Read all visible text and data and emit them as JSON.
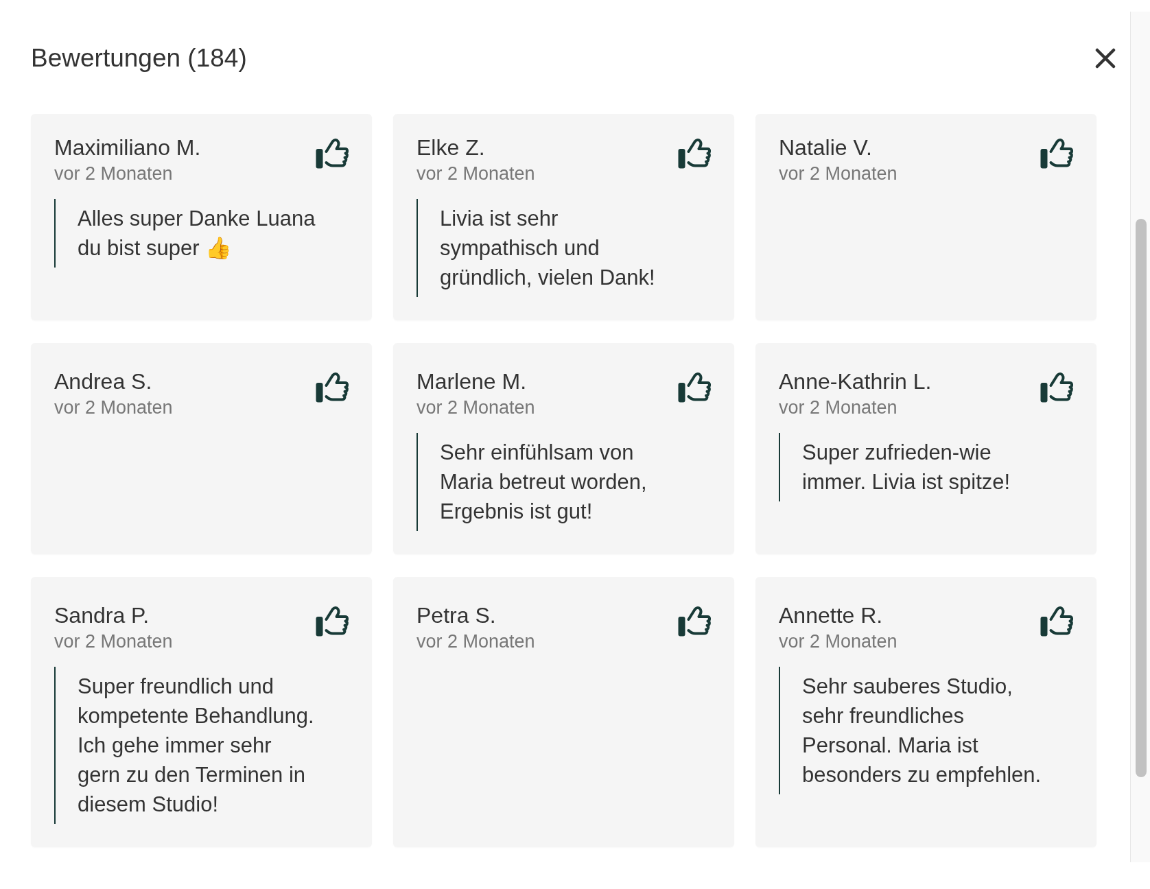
{
  "dialog": {
    "title": "Bewertungen (184)"
  },
  "reviews": [
    {
      "name": "Maximiliano M.",
      "time": "vor 2 Monaten",
      "comment": "Alles super Danke Luana du bist super 👍"
    },
    {
      "name": "Elke Z.",
      "time": "vor 2 Monaten",
      "comment": "Livia ist sehr sympathisch und gründlich, vielen Dank!"
    },
    {
      "name": "Natalie V.",
      "time": "vor 2 Monaten"
    },
    {
      "name": "Andrea S.",
      "time": "vor 2 Monaten"
    },
    {
      "name": "Marlene M.",
      "time": "vor 2 Monaten",
      "comment": "Sehr einfühlsam von Maria betreut worden, Ergebnis ist gut!"
    },
    {
      "name": "Anne-Kathrin L.",
      "time": "vor 2 Monaten",
      "comment": "Super zufrieden-wie immer. Livia ist spitze!"
    },
    {
      "name": "Sandra P.",
      "time": "vor 2 Monaten",
      "comment": "Super freundlich und kompetente Behandlung. Ich gehe immer sehr gern zu den Terminen in diesem Studio!"
    },
    {
      "name": "Petra S.",
      "time": "vor 2 Monaten"
    },
    {
      "name": "Annette R.",
      "time": "vor 2 Monaten",
      "comment": "Sehr sauberes Studio, sehr freundliches Personal. Maria ist besonders zu empfehlen."
    }
  ]
}
